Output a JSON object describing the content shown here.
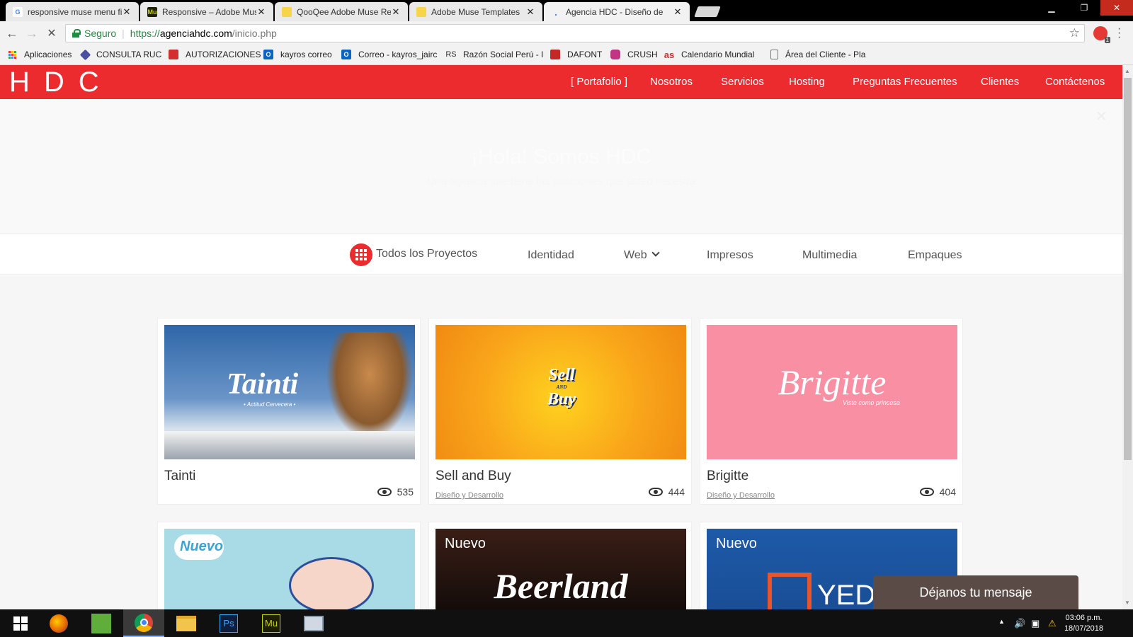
{
  "browser": {
    "tabs": [
      {
        "title": "responsive muse menu fi",
        "favicon": "google-icon",
        "active": false
      },
      {
        "title": "Responsive – Adobe Mus",
        "favicon": "muse-icon",
        "active": false
      },
      {
        "title": "QooQee Adobe Muse Re",
        "favicon": "yellow-square-icon",
        "active": false
      },
      {
        "title": "Adobe Muse Templates",
        "favicon": "yellow-square-icon",
        "active": false
      },
      {
        "title": "Agencia HDC - Diseño de",
        "favicon": "loading-icon",
        "active": true
      }
    ],
    "tab_close": "✕",
    "secure_label": "Seguro",
    "url": {
      "scheme": "https://",
      "host": "agenciahdc.com",
      "path": "/inicio.php"
    },
    "extension_badge": "1",
    "bookmarks": [
      {
        "label": "Aplicaciones",
        "icon": "apps-grid-icon"
      },
      {
        "label": "CONSULTA RUC",
        "icon": "diamond-icon"
      },
      {
        "label": "AUTORIZACIONES",
        "icon": "auth-icon"
      },
      {
        "label": "kayros correo",
        "icon": "outlook-icon"
      },
      {
        "label": "Correo - kayros_jairc",
        "icon": "outlook-icon"
      },
      {
        "label": "Razón Social Perú - I",
        "icon": "rs-icon"
      },
      {
        "label": "DAFONT",
        "icon": "dafont-icon"
      },
      {
        "label": "CRUSH",
        "icon": "instagram-icon"
      },
      {
        "label": "Calendario Mundial",
        "icon": "as-icon"
      },
      {
        "label": "Área del Cliente - Pla",
        "icon": "page-icon"
      }
    ]
  },
  "site": {
    "logo": "HDC",
    "nav": [
      "[ Portafolio ]",
      "Nosotros",
      "Servicios",
      "Hosting",
      "Preguntas Frecuentes",
      "Clientes",
      "Contáctenos"
    ],
    "hero": {
      "title": "¡Hola! Somos HDC",
      "subtitle": "Una agencia que tiene las soluciones que usted necesita"
    },
    "filters": [
      "Todos los Proyectos",
      "Identidad",
      "Web",
      "Impresos",
      "Multimedia",
      "Empaques"
    ],
    "projects": [
      {
        "title": "Tainti",
        "category": "",
        "views": "535",
        "thumb_text": "Tainti",
        "thumb_sub": "• Actitud Cervecera •"
      },
      {
        "title": "Sell and Buy",
        "category": "Diseño y Desarrollo",
        "views": "444",
        "thumb_text": "Sell",
        "thumb_sub": "Buy",
        "thumb_and": "AND"
      },
      {
        "title": "Brigitte",
        "category": "Diseño y Desarrollo",
        "views": "404",
        "thumb_text": "Brigitte",
        "thumb_sub": "Viste como princesa"
      },
      {
        "badge": "Nuevo",
        "thumb_text": ""
      },
      {
        "badge": "Nuevo",
        "thumb_text": "Beerland"
      },
      {
        "badge": "Nuevo",
        "thumb_text": "YED"
      }
    ],
    "chat_label": "Déjanos tu mensaje"
  },
  "taskbar": {
    "time": "03:06 p.m.",
    "date": "18/07/2018",
    "apps": [
      "start-icon",
      "firefox-icon",
      "corel-icon",
      "chrome-icon",
      "file-explorer-icon",
      "photoshop-icon",
      "muse-icon",
      "remote-desktop-icon"
    ],
    "ps_label": "Ps",
    "mu_label": "Mu"
  },
  "colors": {
    "brand_red": "#ec2b2f",
    "chat_bg": "#5a4b46"
  }
}
